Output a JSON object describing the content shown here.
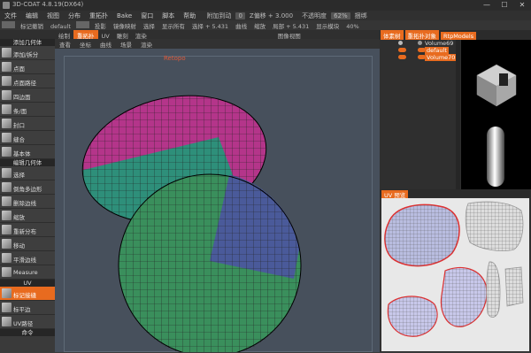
{
  "window": {
    "title": "3D-COAT 4.8.19(DX64)",
    "minimize_glyph": "—",
    "maximize_glyph": "☐",
    "close_glyph": "✕"
  },
  "menubar": {
    "items": [
      "文件",
      "编辑",
      "视图",
      "分布",
      "重拓扑",
      "Bake",
      "窗口",
      "脚本",
      "帮助"
    ],
    "controls": [
      "附加到动",
      "0",
      "Z偏移 + 3.000",
      "不透明度",
      "62%",
      "捆绑"
    ]
  },
  "toolbar1": {
    "items": [
      "标记撤销",
      "default",
      "投影",
      "镜像映射",
      "选择",
      "显示所有",
      "选择 + 5.431",
      "曲线",
      "缩放",
      "局部 + 5.431",
      "显示模块",
      "40%"
    ]
  },
  "toolbar2": {
    "tabs": [
      "绘制",
      "重拓扑",
      "UV",
      "雕刻",
      "渲染"
    ],
    "active_tab": "重拓扑",
    "items": [
      "图像视图"
    ]
  },
  "left_panel": {
    "sections": [
      {
        "title": "添加几何体",
        "tools": [
          "添加/拆分",
          "点面",
          "点面路径",
          "四边面",
          "条/面",
          "封口",
          "缝合",
          "基本体"
        ]
      },
      {
        "title": "编辑几何体",
        "tools": [
          "选择",
          "倒角多边形",
          "删除边线",
          "缩放",
          "重新分布",
          "移动",
          "平滑边线",
          "Measure"
        ]
      },
      {
        "title": "UV",
        "tools": [
          "标记接缝",
          "标平边",
          "UV路径"
        ]
      },
      {
        "title": "命令",
        "tools": []
      }
    ],
    "active_tool": "标记接缝"
  },
  "viewport": {
    "header_items": [
      "查看",
      "坐标",
      "曲线",
      "场景",
      "渲染"
    ],
    "label": "Retopo"
  },
  "right_panel": {
    "tabs": [
      "体素树",
      "重拓扑对象",
      "RtpModels"
    ],
    "active_tabs": [
      "体素树",
      "重拓扑对象",
      "RtpModels"
    ],
    "layers": [
      {
        "name": "Volume69",
        "selected": false
      },
      {
        "name": "default",
        "selected": true
      },
      {
        "name": "Volume70",
        "selected": true
      }
    ],
    "uv_panel_title": "UV 预览"
  },
  "colors": {
    "accent": "#e86b1f",
    "viewport_bg": "#47505c"
  }
}
